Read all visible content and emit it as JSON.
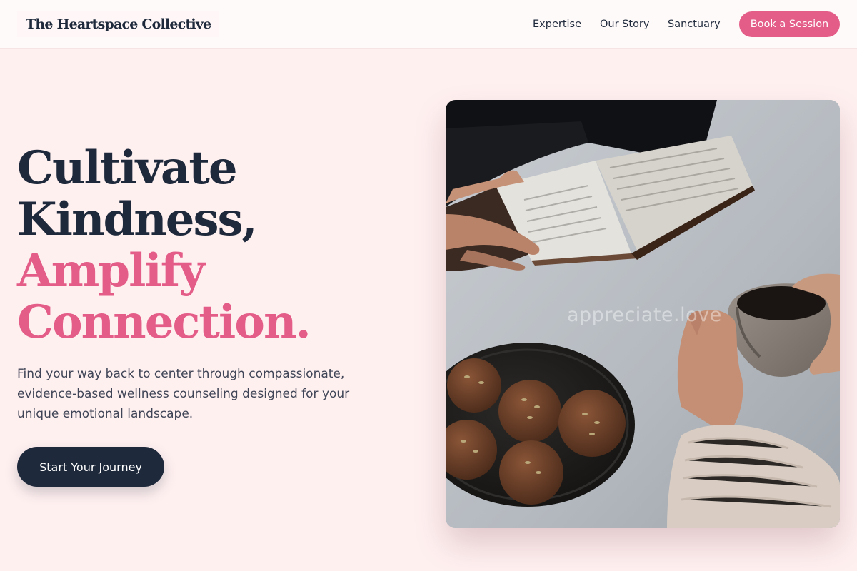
{
  "nav": {
    "brand": "The Heartspace Collective",
    "links": [
      "Expertise",
      "Our Story",
      "Sanctuary"
    ],
    "cta": "Book a Session"
  },
  "hero": {
    "headline": {
      "line1": "Cultivate",
      "line2": "Kindness,",
      "line3": "Amplify",
      "line4": "Connection."
    },
    "subtext": "Find your way back to center through compassionate, evidence-based wellness counseling designed for your unique emotional landscape.",
    "cta": "Start Your Journey"
  },
  "image": {
    "watermark": "appreciate.love"
  },
  "colors": {
    "background": "#fff0f0",
    "navy": "#1e293b",
    "accent_pink": "#e35d88"
  }
}
